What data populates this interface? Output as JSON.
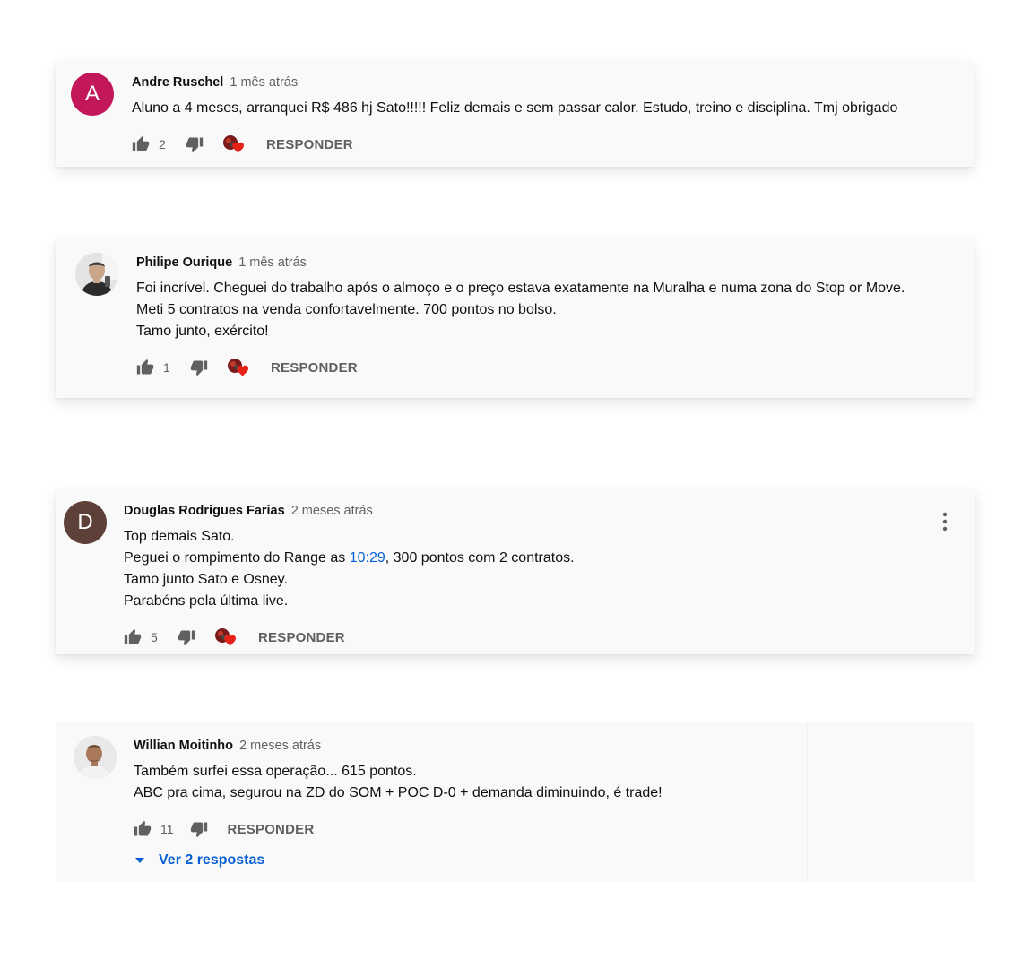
{
  "reply_label": "RESPONDER",
  "colors": {
    "link": "#065fd4",
    "meta": "#606060",
    "heart": "#e62117"
  },
  "comments": [
    {
      "author": "Andre Ruschel",
      "time": "1 mês atrás",
      "avatar_letter": "A",
      "avatar_color": "#c2185b",
      "lines": [
        "Aluno a 4 meses, arranquei R$  486 hj Sato!!!!! Feliz demais  e sem passar calor. Estudo, treino e disciplina. Tmj obrigado"
      ],
      "likes": "2"
    },
    {
      "author": "Philipe Ourique",
      "time": "1 mês atrás",
      "avatar_letter": "",
      "lines": [
        "Foi incrível. Cheguei do trabalho após o almoço e o preço estava exatamente na Muralha e numa zona do Stop or Move.",
        "Meti 5 contratos na venda confortavelmente. 700 pontos no bolso.",
        "Tamo junto, exército!"
      ],
      "likes": "1"
    },
    {
      "author": "Douglas Rodrigues Farias",
      "time": "2 meses atrás",
      "avatar_letter": "D",
      "avatar_color": "#5d4037",
      "line1": "Top demais Sato.",
      "line2_before": "Peguei o rompimento do Range as ",
      "line2_link": "10:29",
      "line2_after": ", 300 pontos com 2 contratos.",
      "line3": "Tamo junto Sato e Osney.",
      "line4": "Parabéns pela última live.",
      "likes": "5"
    },
    {
      "author": "Willian Moitinho",
      "time": "2 meses atrás",
      "avatar_letter": "",
      "lines": [
        "Também surfei essa operação... 615 pontos.",
        "ABC pra cima, segurou na ZD do SOM + POC D-0 + demanda diminuindo, é trade!"
      ],
      "likes": "11",
      "view_replies": "Ver 2 respostas"
    }
  ]
}
